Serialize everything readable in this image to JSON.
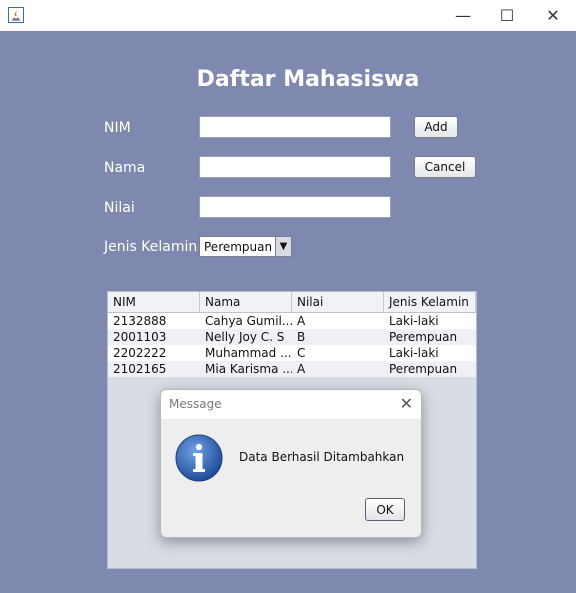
{
  "window": {
    "minimize_glyph": "—",
    "maximize_glyph": "☐",
    "close_glyph": "✕"
  },
  "form": {
    "title": "Daftar Mahasiswa",
    "nim_label": "NIM",
    "nama_label": "Nama",
    "nilai_label": "Nilai",
    "jenis_kelamin_label": "Jenis Kelamin",
    "jenis_kelamin_value": "Perempuan",
    "add_label": "Add",
    "cancel_label": "Cancel",
    "nim_value": "",
    "nama_value": "",
    "nilai_value": ""
  },
  "table": {
    "columns": [
      "NIM",
      "Nama",
      "Nilai",
      "Jenis Kelamin"
    ],
    "rows": [
      [
        "2132888",
        "Cahya Gumil...",
        "A",
        "Laki-laki"
      ],
      [
        "2001103",
        "Nelly Joy C. S",
        "B",
        "Perempuan"
      ],
      [
        "2202222",
        "Muhammad ...",
        "C",
        "Laki-laki"
      ],
      [
        "2102165",
        "Mia Karisma ...",
        "A",
        "Perempuan"
      ]
    ]
  },
  "dialog": {
    "title": "Message",
    "message": "Data Berhasil Ditambahkan",
    "ok_label": "OK",
    "close_glyph": "✕"
  },
  "colors": {
    "background": "#7f89b0",
    "accent_icon": "#2a5fb0"
  },
  "icons": {
    "app": "java-app-icon",
    "info": "info-icon"
  }
}
